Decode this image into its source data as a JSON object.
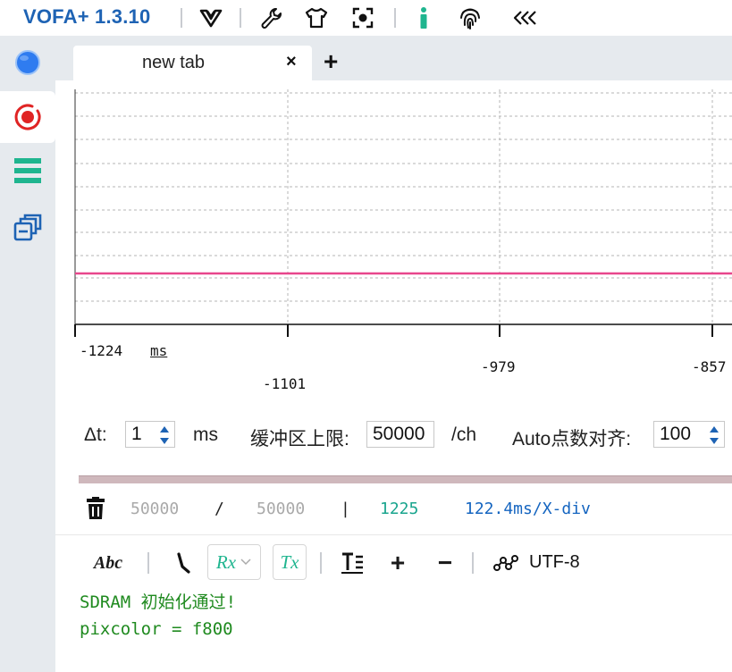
{
  "app": {
    "title": "VOFA+ 1.3.10"
  },
  "toolbar": {
    "icons": [
      "logo-v-icon",
      "wrench-icon",
      "shirt-icon",
      "capture-icon",
      "info-icon",
      "fingerprint-icon",
      "collapse-icon"
    ]
  },
  "sidebar": {
    "items": [
      "connection-status-icon",
      "record-icon",
      "list-icon",
      "windows-icon"
    ]
  },
  "tab": {
    "label": "new tab",
    "close": "×",
    "add": "+"
  },
  "plot": {
    "x_ticks": [
      "-1224",
      "-1101",
      "-979",
      "-857"
    ],
    "x_unit": "ms",
    "series_color": "#e8468c",
    "grid": true
  },
  "controls": {
    "dt_label": "Δt:",
    "dt_value": "1",
    "dt_unit": "ms",
    "buffer_label": "缓冲区上限:",
    "buffer_value": "50000",
    "buffer_unit": "/ch",
    "align_label": "Auto点数对齐:",
    "align_value": "100"
  },
  "status": {
    "count": "50000",
    "slash": "/",
    "total": "50000",
    "bar": "|",
    "points": "1225",
    "scale": "122.4ms/X-div"
  },
  "term_toolbar": {
    "abc": "Abc",
    "rx": "Rx",
    "tx": "Tx",
    "plus": "+",
    "minus": "−",
    "encoding": "UTF-8"
  },
  "terminal": {
    "lines": [
      "SDRAM 初始化通过!",
      "pixcolor = f800"
    ]
  },
  "colors": {
    "accent": "#1e63b4",
    "teal": "#1fb58f",
    "record_red": "#e02424",
    "status_blue": "#1565c0",
    "status_teal": "#1aa58e",
    "terminal_green": "#1f8a1f"
  }
}
